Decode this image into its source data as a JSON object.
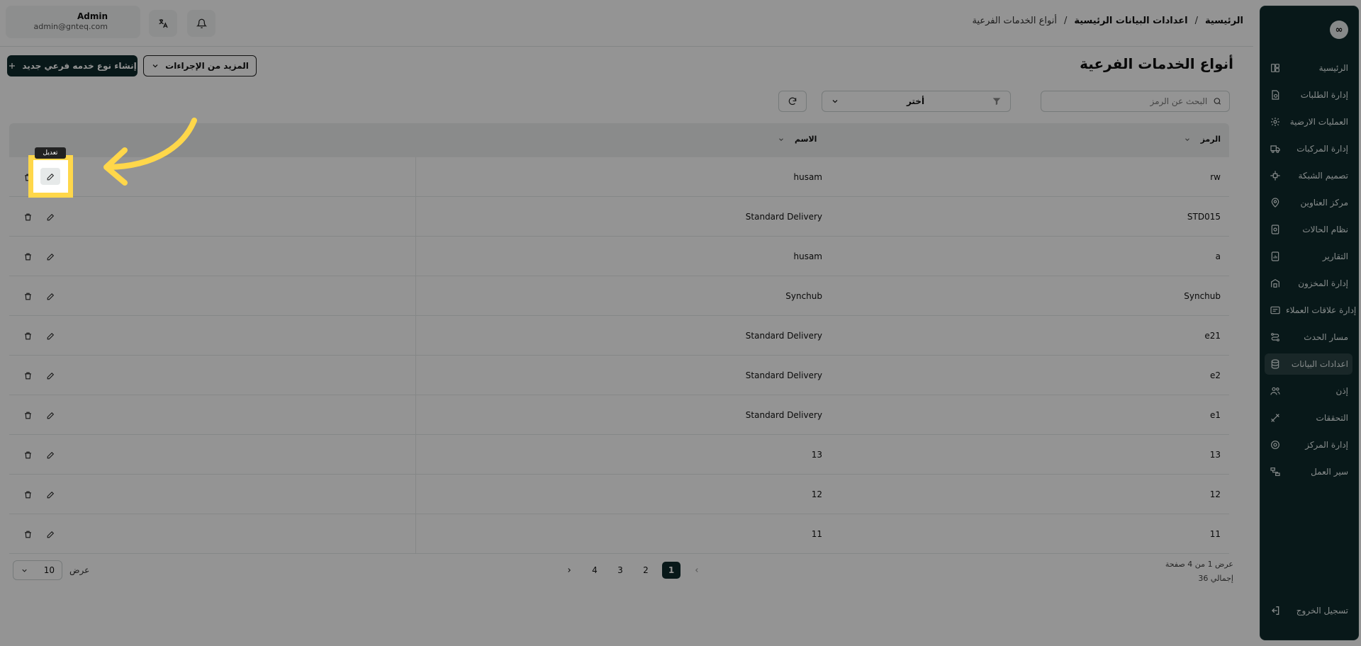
{
  "sidebar": {
    "logo": "∞",
    "items": [
      {
        "label": "الرئيسية",
        "icon": "home-layout-icon"
      },
      {
        "label": "إدارة الطلبات",
        "icon": "orders-icon"
      },
      {
        "label": "العمليات الارضية",
        "icon": "ground-ops-icon"
      },
      {
        "label": "إدارة المركبات",
        "icon": "truck-icon"
      },
      {
        "label": "تصميم الشبكة",
        "icon": "network-icon"
      },
      {
        "label": "مركز العناوين",
        "icon": "map-pin-icon"
      },
      {
        "label": "نظام الحالات",
        "icon": "status-icon"
      },
      {
        "label": "التقارير",
        "icon": "report-icon"
      },
      {
        "label": "إدارة المخزون",
        "icon": "warehouse-icon"
      },
      {
        "label": "إدارة علاقات العملاء",
        "icon": "crm-icon"
      },
      {
        "label": "مسار الحدث",
        "icon": "route-icon"
      },
      {
        "label": "اعدادات البيانات",
        "icon": "database-icon"
      },
      {
        "label": "إذن",
        "icon": "users-icon"
      },
      {
        "label": "التحققات",
        "icon": "tools-icon"
      },
      {
        "label": "إدارة المركز",
        "icon": "hub-icon"
      },
      {
        "label": "سير العمل",
        "icon": "workflow-icon"
      }
    ],
    "active_index": 11,
    "logout_label": "تسجيل الخروج"
  },
  "header": {
    "user_name": "Admin",
    "user_email": "admin@gnteq.com",
    "breadcrumb": [
      "الرئيسية",
      "/",
      "اعدادات البيانات الرئيسية",
      "/",
      "أنواع الخدمات الفرعية"
    ]
  },
  "page": {
    "title": "أنواع الخدمات الفرعية",
    "create_label": "إنشاء نوع خدمه فرعي جديد",
    "more_actions_label": "المزيد من الإجراءات",
    "search_placeholder": "البحث عن الرمز",
    "filter_value": "أختر",
    "tooltip": "تعديل"
  },
  "table": {
    "columns": {
      "code": "الرمز",
      "name": "الاسم"
    },
    "rows": [
      {
        "code": "rw",
        "name": "husam"
      },
      {
        "code": "STD015",
        "name": "Standard Delivery"
      },
      {
        "code": "a",
        "name": "husam"
      },
      {
        "code": "Synchub",
        "name": "Synchub"
      },
      {
        "code": "e21",
        "name": "Standard Delivery"
      },
      {
        "code": "e2",
        "name": "Standard Delivery"
      },
      {
        "code": "e1",
        "name": "Standard Delivery"
      },
      {
        "code": "13",
        "name": "13"
      },
      {
        "code": "12",
        "name": "12"
      },
      {
        "code": "11",
        "name": "11"
      }
    ]
  },
  "pagination": {
    "pages": [
      "1",
      "2",
      "3",
      "4"
    ],
    "current": "1",
    "page_info": "عرض 1 من 4 صفحة",
    "total": "إجمالي 36",
    "page_size": "10",
    "show_label": "عرض"
  },
  "colors": {
    "sidebar_bg": "#0f2a2b",
    "highlight": "#ffd74a",
    "primary": "#0f2a2b"
  }
}
